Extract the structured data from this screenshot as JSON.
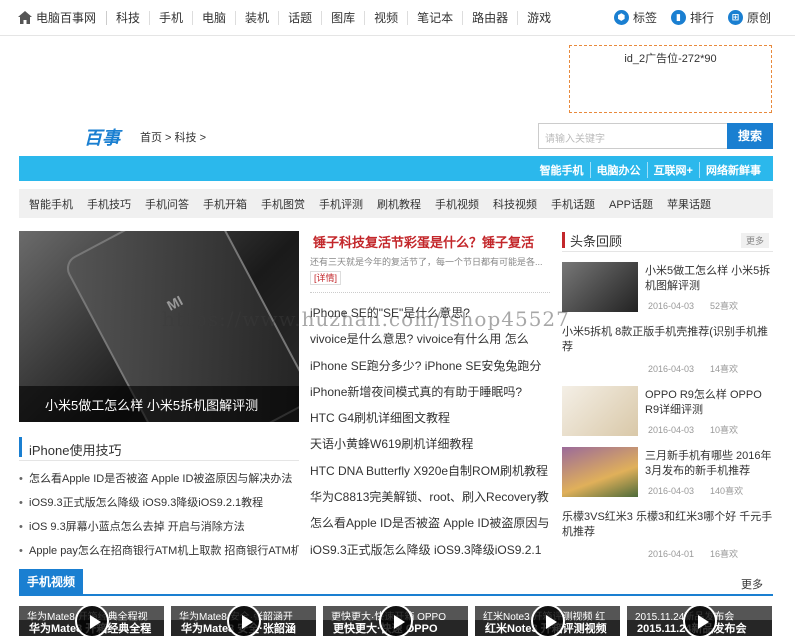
{
  "topbar": {
    "site_name": "电脑百事网",
    "nav": [
      "科技",
      "手机",
      "电脑",
      "装机",
      "话题",
      "图库",
      "视频",
      "笔记本",
      "路由器",
      "游戏"
    ],
    "right": [
      {
        "label": "标签",
        "icon": "tag-icon"
      },
      {
        "label": "排行",
        "icon": "bar-chart-icon"
      },
      {
        "label": "原创",
        "icon": "windows-icon"
      }
    ]
  },
  "ad_text": "id_2广告位-272*90",
  "logo_text": "百事",
  "breadcrumb": "首页 > 科技 >",
  "search": {
    "placeholder": "请输入关键字",
    "button": "搜索"
  },
  "bluebar_links": [
    "智能手机",
    "电脑办公",
    "互联网+",
    "网络新鲜事"
  ],
  "categories": [
    "智能手机",
    "手机技巧",
    "手机问答",
    "手机开箱",
    "手机图赏",
    "手机评测",
    "刷机教程",
    "手机视频",
    "科技视频",
    "手机话题",
    "APP话题",
    "苹果话题"
  ],
  "hero_caption": "小米5做工怎么样 小米5拆机图解评测",
  "iphone_box": {
    "title": "iPhone使用技巧",
    "items": [
      "怎么看Apple ID是否被盗 Apple ID被盗原因与解决办法",
      "iOS9.3正式版怎么降级 iOS9.3降级iOS9.2.1教程",
      "iOS 9.3屏幕小蓝点怎么去掉 开启与消除方法",
      "Apple pay怎么在招商银行ATM机上取款 招商银行ATM机"
    ]
  },
  "headline": {
    "title": "锤子科技复活节彩蛋是什么？锤子复活",
    "summary": "还有三天就是今年的复活节了，每一个节日都有可能是各...",
    "more": "[详情]"
  },
  "mid_list": [
    "iPhone SE的\"SE\"是什么意思?",
    "vivoice是什么意思? vivoice有什么用 怎么",
    "iPhone SE跑分多少? iPhone SE安兔兔跑分",
    "iPhone新增夜间模式真的有助于睡眠吗?",
    "HTC G4刷机详细图文教程",
    "天语小黄蜂W619刷机详细教程",
    "HTC DNA Butterfly X920e自制ROM刷机教程",
    "华为C8813完美解锁、root、刷入Recovery教",
    "怎么看Apple ID是否被盗 Apple ID被盗原因与",
    "iOS9.3正式版怎么降级 iOS9.3降级iOS9.2.1"
  ],
  "right_col": {
    "title": "头条回顾",
    "more": "更多",
    "items": [
      {
        "title": "小米5做工怎么样 小米5拆机图解评测",
        "date": "2016-04-03",
        "views": "52喜欢"
      },
      {
        "title": "小米5拆机 8款正版手机壳推荐(识别手机推荐",
        "date": "2016-04-03",
        "views": "14喜欢"
      },
      {
        "title": "OPPO R9怎么样 OPPO R9详细评测",
        "date": "2016-04-03",
        "views": "10喜欢"
      },
      {
        "title": "三月新手机有哪些 2016年3月发布的新手机推荐",
        "date": "2016-04-03",
        "views": "140喜欢"
      },
      {
        "title": "乐檬3VS红米3 乐檬3和红米3哪个好 千元手机推荐",
        "date": "2016-04-01",
        "views": "16喜欢"
      }
    ]
  },
  "video_section": {
    "title": "手机视频",
    "more": "更多",
    "items": [
      {
        "top": "华为Mate8 开箱经典全程视",
        "bottom": "华为Mate8 开箱经典全程"
      },
      {
        "top": "华为Mate8 安全·张韶涵开",
        "bottom": "华为Mate8 安全·张韶涵"
      },
      {
        "top": "更快更大·快速开箱 OPPO",
        "bottom": "更快更大·快速 OPPO"
      },
      {
        "top": "红米Note3 开箱评测视频 红",
        "bottom": "红米Note3 开箱评测视频"
      },
      {
        "top": "2015.11.24新品发布会",
        "bottom": "2015.11.24新品发布会"
      }
    ]
  },
  "watermark": "https://www.huzhan.com/ishop45527"
}
